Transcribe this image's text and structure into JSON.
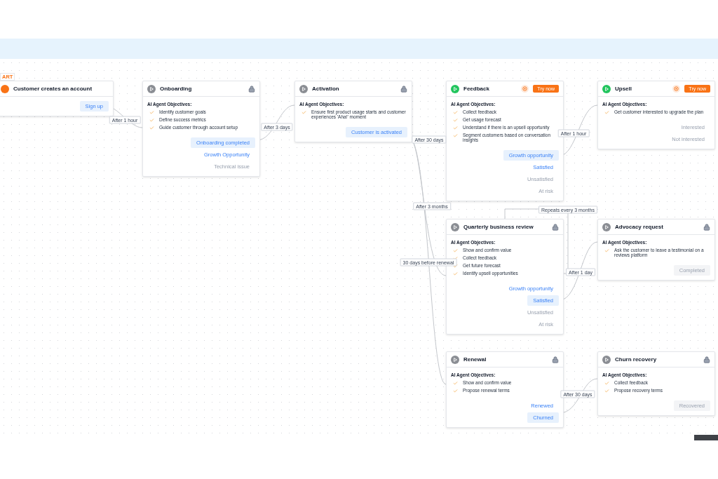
{
  "nodes": [
    {
      "kind": "start",
      "tag": "ART",
      "title": "Customer creates an account",
      "outputs": [
        {
          "label": "Sign up",
          "kind": "connected"
        }
      ]
    },
    {
      "kind": "locked",
      "title": "Onboarding",
      "objectives_heading": "AI Agent Objectives:",
      "objectives": [
        "Identify customer goals",
        "Define success metrics",
        "Guide customer through account setup"
      ],
      "outputs": [
        {
          "label": "Onboarding completed",
          "kind": "connected"
        },
        {
          "label": "Growth Opportunity",
          "kind": "available"
        },
        {
          "label": "Technical issue",
          "kind": "inactive"
        }
      ]
    },
    {
      "kind": "locked",
      "title": "Activation",
      "objectives_heading": "AI Agent Objectives:",
      "objectives": [
        "Ensure first product usage starts and customer experiences 'Aha!' moment"
      ],
      "outputs": [
        {
          "label": "Customer is activated",
          "kind": "connected"
        }
      ]
    },
    {
      "kind": "live",
      "title": "Feedback",
      "action": "Try now",
      "objectives_heading": "AI Agent Objectives:",
      "objectives": [
        "Collect feedback",
        "Get usage forecast",
        "Understand if there is an upsell opportunity",
        "Segment customers based on conversation insights"
      ],
      "outputs": [
        {
          "label": "Growth opportunity",
          "kind": "connected"
        },
        {
          "label": "Satisfied",
          "kind": "available"
        },
        {
          "label": "Unsatisfied",
          "kind": "inactive"
        },
        {
          "label": "At risk",
          "kind": "inactive"
        }
      ]
    },
    {
      "kind": "live",
      "title": "Upsell",
      "action": "Try now",
      "objectives_heading": "AI Agent Objectives:",
      "objectives": [
        "Get customer interested to upgrade the plan"
      ],
      "outputs": [
        {
          "label": "Interested",
          "kind": "inactive"
        },
        {
          "label": "Not interested",
          "kind": "inactive"
        }
      ]
    },
    {
      "kind": "locked",
      "title": "Quarterly business review",
      "objectives_heading": "AI Agent Objectives:",
      "objectives": [
        "Show and confirm value",
        "Collect feedback",
        "Get future forecast",
        "Identify upsell opportunities"
      ],
      "outputs": [
        {
          "label": "Growth opportunity",
          "kind": "available"
        },
        {
          "label": "Satisfied",
          "kind": "connected"
        },
        {
          "label": "Unsatisfied",
          "kind": "inactive"
        },
        {
          "label": "At risk",
          "kind": "inactive"
        }
      ]
    },
    {
      "kind": "locked",
      "title": "Advocacy request",
      "objectives_heading": "AI Agent Objectives:",
      "objectives": [
        "Ask the customer to leave a testimonial on a reviews platform"
      ],
      "outputs": [
        {
          "label": "Completed",
          "kind": "disabled"
        }
      ]
    },
    {
      "kind": "locked",
      "title": "Renewal",
      "objectives_heading": "AI Agent Objectives:",
      "objectives": [
        "Show and confirm value",
        "Propose renewal terms"
      ],
      "outputs": [
        {
          "label": "Renewed",
          "kind": "available"
        },
        {
          "label": "Churned",
          "kind": "connected"
        }
      ]
    },
    {
      "kind": "locked",
      "title": "Churn recovery",
      "objectives_heading": "AI Agent Objectives:",
      "objectives": [
        "Collect feedback",
        "Propose recovery terms"
      ],
      "outputs": [
        {
          "label": "Recovered",
          "kind": "disabled"
        }
      ]
    }
  ],
  "edges": [
    {
      "label": "After 1 hour"
    },
    {
      "label": "After 3 days"
    },
    {
      "label": "After 30 days"
    },
    {
      "label": "After 3 months"
    },
    {
      "label": "30 days before renewal"
    },
    {
      "label": "After 1 hour"
    },
    {
      "label": "Repeats every 3 months"
    },
    {
      "label": "After 1 day"
    },
    {
      "label": "After 30 days"
    }
  ]
}
